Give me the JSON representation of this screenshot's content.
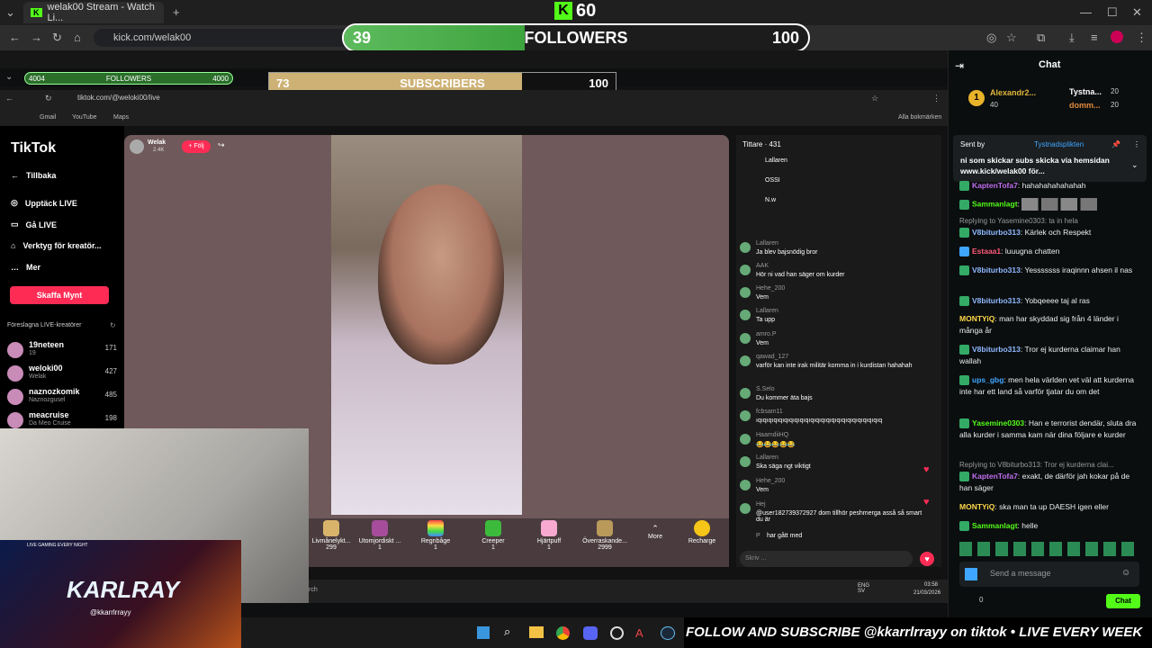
{
  "outer_browser": {
    "tab_title": "welak00 Stream - Watch Li...",
    "url": "kick.com/welak00"
  },
  "overlay": {
    "kick_count": "60",
    "followers": {
      "current": "39",
      "label": "FOLLOWERS",
      "goal": "100",
      "progress": 0.39
    },
    "mini_followers": {
      "current": "4004",
      "label": "FOLLOWERS",
      "goal": "4000"
    },
    "subscribers": {
      "current": "73",
      "label": "SUBSCRIBERS",
      "goal": "100",
      "progress": 0.73
    }
  },
  "inner_browser": {
    "url": "tiktok.com/@weloki00/live",
    "bookmarks": [
      "Gmail",
      "YouTube",
      "Maps"
    ],
    "all_bookmarks": "Alla bokmärken"
  },
  "tiktok": {
    "brand": "TikTok",
    "nav": [
      "Tillbaka",
      "Upptäck LIVE",
      "Gå LIVE",
      "Verktyg för kreatör...",
      "Mer"
    ],
    "get_coins": "Skaffa Mynt",
    "suggested_title": "Föreslagna LIVE-kreatörer",
    "creators": [
      {
        "name": "19neteen",
        "sub": "19",
        "count": "171"
      },
      {
        "name": "weloki00",
        "sub": "Welak",
        "count": "427"
      },
      {
        "name": "naznozkomik",
        "sub": "Naznozgusel",
        "count": "485"
      },
      {
        "name": "meacruise",
        "sub": "Da Meo Cruise",
        "count": "198"
      }
    ],
    "host": {
      "name": "Welak",
      "followers": "2.4K",
      "follow": "+ Följ"
    },
    "viewers_label": "Tittare · 431",
    "top_viewers": [
      "Lallaren",
      "OSSI",
      "N.w"
    ],
    "gifts": [
      {
        "name": "Livmånelykt...",
        "price": "299"
      },
      {
        "name": "Utomjordiskt ...",
        "price": "1"
      },
      {
        "name": "Regnbåge",
        "price": "1"
      },
      {
        "name": "Creeper",
        "price": "1"
      },
      {
        "name": "Hjärtpuff",
        "price": "1"
      },
      {
        "name": "Överraskande...",
        "price": "2999"
      }
    ],
    "more": "More",
    "recharge": "Recharge",
    "chat_input": "Skriv ...",
    "chat": [
      {
        "user": "Lallaren",
        "text": "Ja blev bajsnödig bror"
      },
      {
        "user": "AAK",
        "text": "Hör ni vad han säger om kurder"
      },
      {
        "user": "Hehe_200",
        "text": "Vem"
      },
      {
        "user": "Lallaren",
        "text": "Ta upp"
      },
      {
        "user": "amro.P",
        "text": "Vem"
      },
      {
        "user": "qawad_127",
        "text": "varför kan inte irak militär komma in i kurdistan hahahah"
      },
      {
        "user": "S.Selo",
        "text": "Du kommer äta bajs"
      },
      {
        "user": "fcbsam11",
        "text": "ıqıqıqıqıqıqıqıqıqıqıqıqıqıqıqıqıqıqıqıqıqıqıqıq"
      },
      {
        "user": "HaamdiiHQ",
        "text": "😂😂😂😂😂"
      },
      {
        "user": "Lallaren",
        "text": "Ska säga ngt viktigt"
      },
      {
        "user": "Hehe_200",
        "text": "Vem"
      },
      {
        "user": "Hej",
        "text": "@user182739372927 dom tillhör peshmerga asså så smart du är"
      },
      {
        "user": "P",
        "text": "har gått med"
      }
    ]
  },
  "inner_taskbar": {
    "search": "rch",
    "lang": "ENG\nSV",
    "time": "03:58",
    "date": "21/03/2026"
  },
  "ticker": "FOLLOW AND SUBSCRIBE @kkarrlrrayy on tiktok • LIVE EVERY WEEK",
  "banner": {
    "name": "KARLRAY",
    "handle": "@kkarrlrrayy",
    "top": "LIVE GAMING EVERY NIGHT"
  },
  "kick_chat": {
    "title": "Chat",
    "leaderboard": [
      {
        "name": "Alexandr2...",
        "count": "40"
      },
      {
        "name": "Tystna...",
        "count": "20"
      },
      {
        "name": "domm...",
        "count": "20"
      }
    ],
    "pinned": {
      "sent_by": "Sent by",
      "user": "Tystnadsplikten",
      "text": "ni som skickar subs skicka via hemsidan www.kick/welak00 för..."
    },
    "messages": [
      {
        "user": "KaptenTofa7",
        "text": "hahahahahahahah",
        "color": "#c06ef0"
      },
      {
        "user": "Sammanlagt",
        "text": "",
        "color": "#53fc18"
      },
      {
        "reply": "Replying to Yasemine0303: ta in hela"
      },
      {
        "user": "V8biturbo313",
        "text": "Kärlek och Respekt",
        "color": "#8fb8ff"
      },
      {
        "user": "Estaaa1",
        "text": "luuugna chatten",
        "color": "#ff5b7a"
      },
      {
        "user": "V8biturbo313",
        "text": "Yesssssss iraqinnn ahsen il nas",
        "color": "#8fb8ff"
      },
      {
        "user": "V8biturbo313",
        "text": "Yobqeeee taj al ras",
        "color": "#8fb8ff"
      },
      {
        "user": "MONTYiQ",
        "text": "man har skyddad sig från 4 länder i många år",
        "color": "#ffd84a"
      },
      {
        "user": "V8biturbo313",
        "text": "Tror ej kurderna claimar han wallah",
        "color": "#8fb8ff"
      },
      {
        "user": "ups_gbg",
        "text": "men hela världen vet väl att kurderna inte har ett land så varför tjatar du om det",
        "color": "#3ea6ff"
      },
      {
        "user": "Yasemine0303",
        "text": "Han e terrorist dendär, sluta dra alla kurder i samma kam när dina följare e kurder",
        "color": "#53fc18"
      },
      {
        "reply": "Replying to V8biturbo313: Tror ej kurderna clai..."
      },
      {
        "user": "KaptenTofa7",
        "text": "exakt, de därför jah kokar på de han säger",
        "color": "#c06ef0"
      },
      {
        "user": "MONTYiQ",
        "text": "ska man ta up DAESH igen eller",
        "color": "#ffd84a"
      },
      {
        "user": "Sammanlagt",
        "text": "helle",
        "color": "#53fc18"
      }
    ],
    "input_placeholder": "Send a message",
    "chat_button": "Chat",
    "count": "0"
  }
}
